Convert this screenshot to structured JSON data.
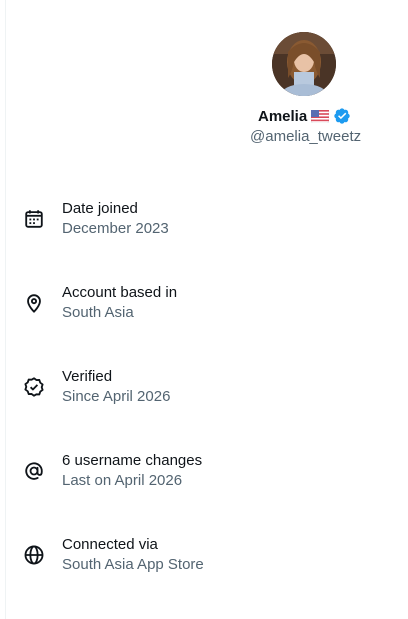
{
  "profile": {
    "name": "Amelia",
    "handle": "@amelia_tweetz",
    "flag_icon": "us-flag-icon",
    "verified_icon": "verified-badge-icon",
    "accent_color": "#1d9bf0"
  },
  "about_rows": [
    {
      "icon": "calendar-icon",
      "title": "Date joined",
      "subtitle": "December 2023"
    },
    {
      "icon": "location-pin-icon",
      "title": "Account based in",
      "subtitle": "South Asia"
    },
    {
      "icon": "verified-outline-icon",
      "title": "Verified",
      "subtitle": "Since April 2026"
    },
    {
      "icon": "at-sign-icon",
      "title": "6 username changes",
      "subtitle": "Last on April 2026"
    },
    {
      "icon": "globe-icon",
      "title": "Connected via",
      "subtitle": "South Asia App Store"
    }
  ],
  "colors": {
    "primary_text": "#0f1419",
    "secondary_text": "#536471"
  }
}
